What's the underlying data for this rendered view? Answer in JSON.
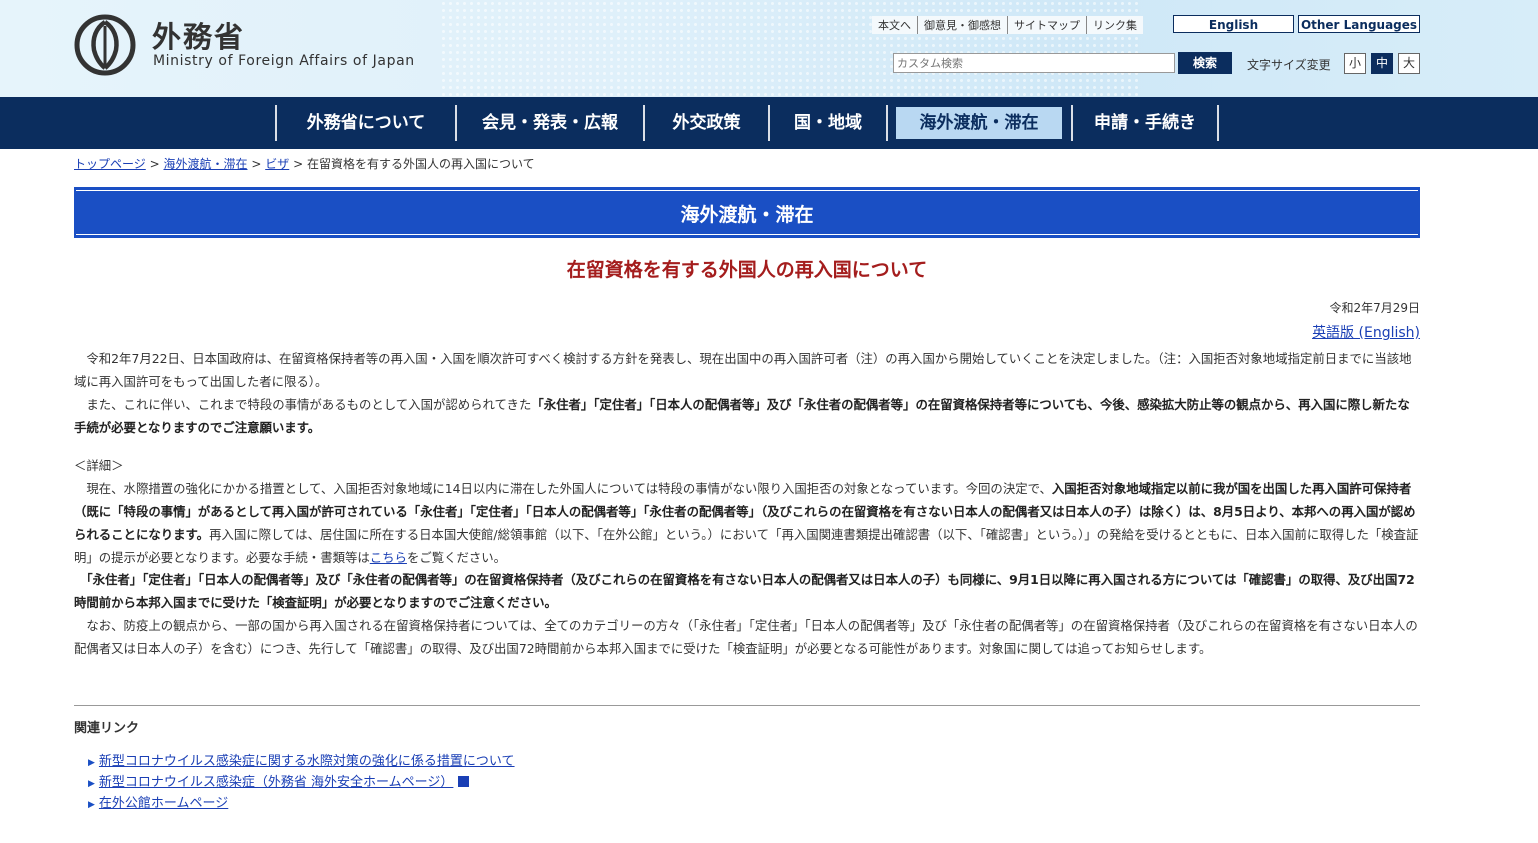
{
  "header": {
    "title": "外務省",
    "subtitle": "Ministry of Foreign Affairs of Japan",
    "utility_links": [
      "本文へ",
      "御意見・御感想",
      "サイトマップ",
      "リンク集"
    ],
    "english_button": "English",
    "other_languages_button": "Other Languages",
    "search_placeholder": "カスタム検索",
    "search_button": "検索",
    "font_size_label": "文字サイズ変更",
    "font_sizes": [
      "小",
      "中",
      "大"
    ]
  },
  "nav": {
    "items": [
      "外務省について",
      "会見・発表・広報",
      "外交政策",
      "国・地域",
      "海外渡航・滞在",
      "申請・手続き"
    ],
    "active": "海外渡航・滞在"
  },
  "breadcrumb": {
    "items": [
      "トップページ",
      "海外渡航・滞在",
      "ビザ"
    ],
    "current": "在留資格を有する外国人の再入国について",
    "separator": ">"
  },
  "category_title": "海外渡航・滞在",
  "page_title": "在留資格を有する外国人の再入国について",
  "date": "令和2年7月29日",
  "english_link": "英語版 (English)",
  "body": {
    "p1": "　令和2年7月22日、日本国政府は、在留資格保持者等の再入国・入国を順次許可すべく検討する方針を発表し、現在出国中の再入国許可者（注）の再入国から開始していくことを決定しました。（注：入国拒否対象地域指定前日までに当該地域に再入国許可をもって出国した者に限る）。",
    "p2a": "　また、これに伴い、これまで特段の事情があるものとして入国が認められてきた",
    "p2b": "「永住者」「定住者」「日本人の配偶者等」及び「永住者の配偶者等」の在留資格保持者等についても、今後、感染拡大防止等の観点から、再入国に際し新たな手続が必要となりますのでご注意願います。",
    "detail_heading": "＜詳細＞",
    "p3a": "　現在、水際措置の強化にかかる措置として、入国拒否対象地域に14日以内に滞在した外国人については特段の事情がない限り入国拒否の対象となっています。今回の決定で、",
    "p3b": "入国拒否対象地域指定以前に我が国を出国した再入国許可保持者（既に「特段の事情」があるとして再入国が許可されている「永住者」「定住者」「日本人の配偶者等」「永住者の配偶者等」（及びこれらの在留資格を有さない日本人の配偶者又は日本人の子）は除く）は、8月5日より、本邦への再入国が認められることになります。",
    "p3c": "再入国に際しては、居住国に所在する日本国大使館/総領事館（以下、「在外公館」という。）において「再入国関連書類提出確認書（以下、「確認書」という。）」の発給を受けるとともに、日本入国前に取得した「検査証明」の提示が必要となります。必要な手続・書類等は",
    "p3_link": "こちら",
    "p3d": "をご覧ください。",
    "p4": "　「永住者」「定住者」「日本人の配偶者等」及び「永住者の配偶者等」の在留資格保持者（及びこれらの在留資格を有さない日本人の配偶者又は日本人の子）も同様に、9月1日以降に再入国される方については「確認書」の取得、及び出国72時間前から本邦入国までに受けた「検査証明」が必要となりますのでご注意ください。",
    "p5": "　なお、防疫上の観点から、一部の国から再入国される在留資格保持者については、全てのカテゴリーの方々（「永住者」「定住者」「日本人の配偶者等」及び「永住者の配偶者等」の在留資格保持者（及びこれらの在留資格を有さない日本人の配偶者又は日本人の子）を含む）につき、先行して「確認書」の取得、及び出国72時間前から本邦入国までに受けた「検査証明」が必要となる可能性があります。対象国に関しては追ってお知らせします。"
  },
  "related": {
    "heading": "関連リンク",
    "links": [
      "新型コロナウイルス感染症に関する水際対策の強化に係る措置について",
      "新型コロナウイルス感染症（外務省 海外安全ホームページ）",
      "在外公館ホームページ"
    ]
  },
  "colors": {
    "nav_bg": "#0b2d5e",
    "nav_active_bg": "#b9d8f2",
    "category_band": "#1a4fc4",
    "title_red": "#a41d1d",
    "link": "#1a3fb5"
  }
}
